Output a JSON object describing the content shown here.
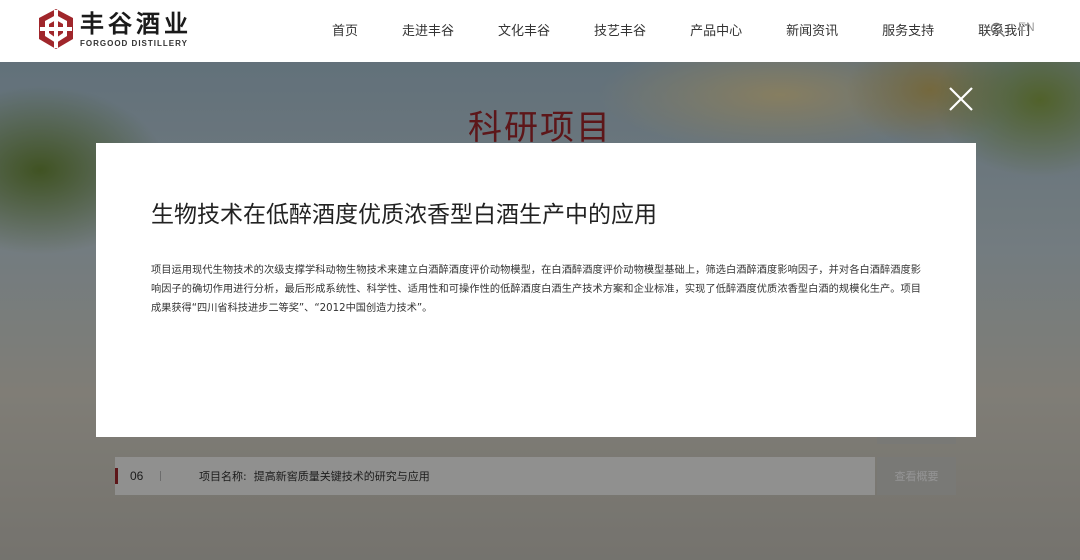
{
  "header": {
    "logo_cn": "丰谷酒业",
    "logo_en": "FORGOOD DISTILLERY",
    "nav": [
      "首页",
      "走进丰谷",
      "文化丰谷",
      "技艺丰谷",
      "产品中心",
      "新闻资讯",
      "服务支持",
      "联系我们"
    ],
    "lang": "EN",
    "search_icon": "search-icon"
  },
  "page": {
    "title": "科研项目",
    "row": {
      "number": "06",
      "name_prefix": "项目名称:",
      "name": "提高新窖质量关键技术的研究与应用",
      "button": "查看概要"
    }
  },
  "modal": {
    "title": "生物技术在低醉酒度优质浓香型白酒生产中的应用",
    "body": "项目运用现代生物技术的次级支撑学科动物生物技术来建立白酒醉酒度评价动物模型，在白酒醉酒度评价动物模型基础上，筛选白酒醉酒度影响因子，并对各白酒醉酒度影响因子的确切作用进行分析，最后形成系统性、科学性、适用性和可操作性的低醉酒度白酒生产技术方案和企业标准，实现了低醉酒度优质浓香型白酒的规模化生产。项目成果获得“四川省科技进步二等奖”、“2012中国创造力技术”。",
    "close_icon": "close-icon"
  },
  "colors": {
    "brand_red": "#a0262b",
    "overlay": "rgba(0,0,0,0.42)"
  }
}
